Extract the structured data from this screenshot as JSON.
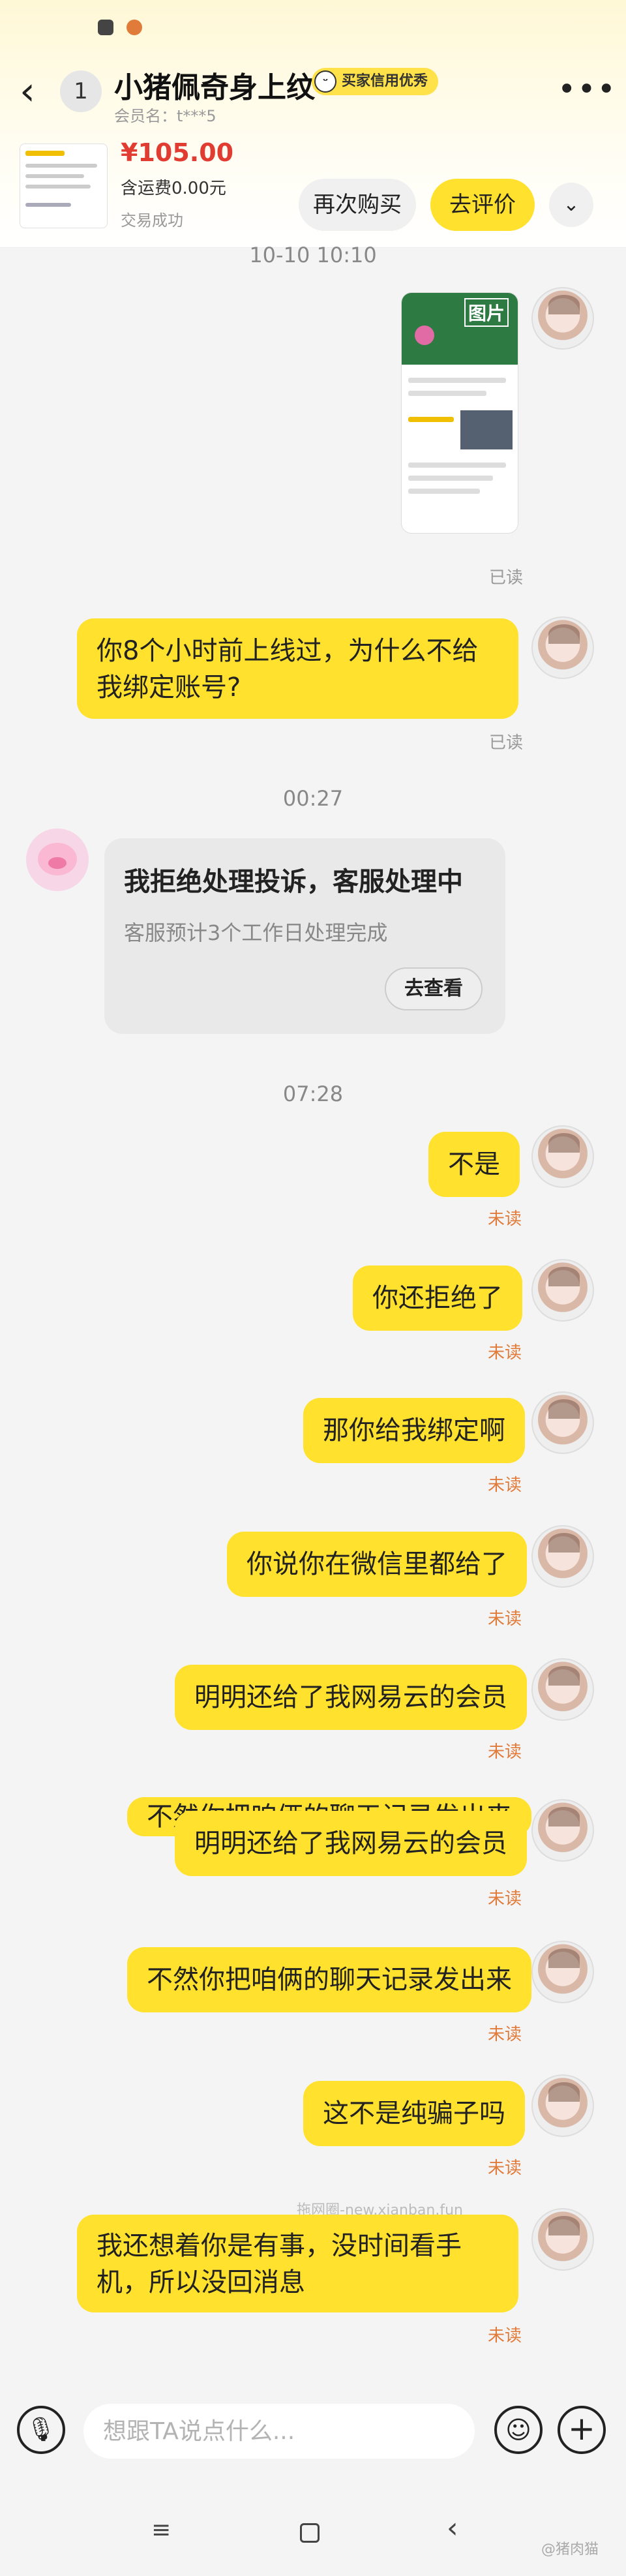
{
  "header": {
    "back_icon": "chevron-left-icon",
    "unread_count": "1",
    "title": "小猪佩奇身上纹",
    "credit_badge": "买家信用优秀",
    "member_name": "会员名：t***5",
    "more_icon": "more-dots-icon"
  },
  "order": {
    "price": "¥105.00",
    "shipping": "含运费0.00元",
    "status": "交易成功",
    "rebuy_label": "再次购买",
    "review_label": "去评价"
  },
  "chat": {
    "time_1": "10-10 10:10",
    "image_label": "图片",
    "read_1": "已读",
    "msg_1": "你8个小时前上线过，为什么不给我绑定账号?",
    "read_2": "已读",
    "time_2": "00:27",
    "card_title": "我拒绝处理投诉，客服处理中",
    "card_sub": "客服预计3个工作日处理完成",
    "card_btn": "去查看",
    "time_3": "07:28",
    "messages": [
      {
        "text": "不是",
        "status": "未读"
      },
      {
        "text": "你还拒绝了",
        "status": "未读"
      },
      {
        "text": "那你给我绑定啊",
        "status": "未读"
      },
      {
        "text": "你说你在微信里都给了",
        "status": "未读"
      },
      {
        "text": "明明还给了我网易云的会员",
        "status": "未读"
      },
      {
        "text": "明明还给了我网易云的会员",
        "status": "未读"
      },
      {
        "text": "不然你把咱俩的聊天记录发出来",
        "status": "未读"
      },
      {
        "text": "这不是纯骗子吗",
        "status": "未读"
      },
      {
        "text": "我还想着你是有事，没时间看手机，所以没回消息",
        "status": "未读"
      }
    ],
    "ghost_text": "不然你把咱俩的聊天记录发出来",
    "watermark": "拖网圈-new.xianban.fun"
  },
  "input": {
    "placeholder": "想跟TA说点什么...",
    "mic_icon": "microphone-icon",
    "emoji_icon": "emoji-icon",
    "plus_icon": "plus-icon"
  },
  "footer_watermark": "@猪肉猫"
}
